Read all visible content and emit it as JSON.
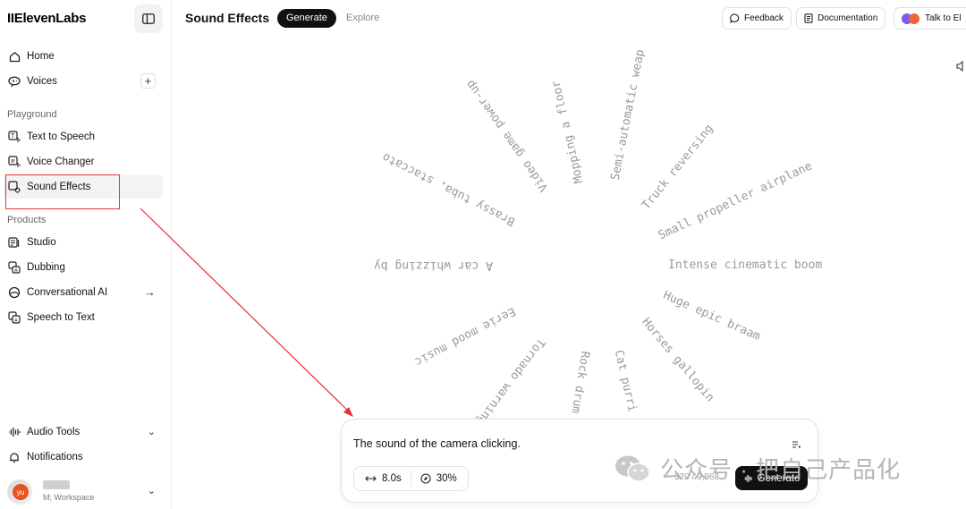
{
  "sidebar": {
    "brand": "IIElevenLabs",
    "home": "Home",
    "voices": "Voices",
    "section_playground": "Playground",
    "text_to_speech": "Text to Speech",
    "voice_changer": "Voice Changer",
    "sound_effects": "Sound Effects",
    "section_products": "Products",
    "studio": "Studio",
    "dubbing": "Dubbing",
    "conversational_ai": "Conversational AI",
    "speech_to_text": "Speech to Text",
    "audio_tools": "Audio Tools",
    "notifications": "Notifications",
    "workspace_sub": "M; Workspace",
    "avatar_initials": "yu"
  },
  "header": {
    "title": "Sound Effects",
    "tab_generate": "Generate",
    "tab_explore": "Explore",
    "feedback": "Feedback",
    "documentation": "Documentation",
    "talk_to": "Talk to El"
  },
  "wheel": {
    "items": [
      "Intense cinematic boom",
      "Huge epic braam",
      "Horses gallopin",
      "Cat purri",
      "Rock drum",
      "Tornado warning",
      "Eerie mood music",
      "A car whizzing by",
      "Brassy tuba, staccato",
      "Video game power-up",
      "Mopping a floor",
      "Semi-automatic weap",
      "Truck reversing",
      "Small propeller airplane"
    ]
  },
  "prompt": {
    "text": "The sound of the camera clicking.",
    "duration": "8.0s",
    "influence": "30%",
    "char_count": "320 / 9,968",
    "generate": "Generate"
  },
  "watermark": {
    "text": "公众号 · 把自己产品化"
  },
  "colors": {
    "accent": "#111111",
    "annotation_red": "#e8312f",
    "wheel_text": "#9a9a9a"
  }
}
